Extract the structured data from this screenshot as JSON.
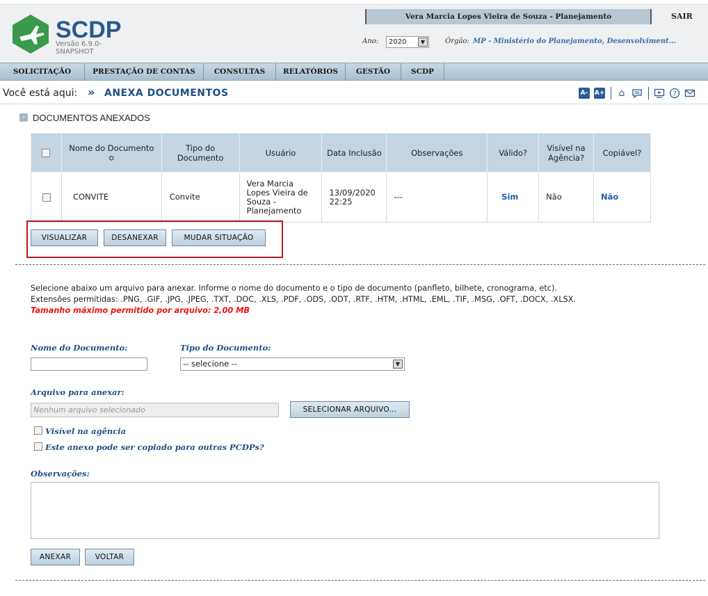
{
  "header": {
    "logo_text": "SCDP",
    "version": "Versão 6.9.0-",
    "version_tag": "SNAPSHOT",
    "user": "Vera Marcia Lopes Vieira de Souza - Planejamento",
    "logout": "SAIR",
    "ano_label": "Ano:",
    "ano_value": "2020",
    "orgao_label": "Órgão:",
    "orgao_value": "MP - Ministério do Planejamento, Desenvolviment...",
    "brand_color": "#2a5a8a",
    "logo_color": "#3a9a4a"
  },
  "nav": {
    "items": [
      "SOLICITAÇÃO",
      "PRESTAÇÃO DE CONTAS",
      "CONSULTAS",
      "RELATÓRIOS",
      "GESTÃO",
      "SCDP"
    ]
  },
  "breadcrumb": {
    "label": "Você está aqui:",
    "current": "ANEXA DOCUMENTOS",
    "tools": [
      "A-",
      "A+",
      "home-icon",
      "chat-icon",
      "video-icon",
      "help-icon",
      "mail-icon"
    ]
  },
  "section": {
    "title": "DOCUMENTOS ANEXADOS",
    "columns": [
      "Nome do Documento ≎",
      "Tipo do Documento",
      "Usuário",
      "Data Inclusão",
      "Observações",
      "Válido?",
      "Visível na Agência?",
      "Copiável?"
    ],
    "rows": [
      {
        "nome": "CONVITE",
        "tipo": "Convite",
        "usuario": "Vera Marcia Lopes Vieira de Souza - Planejamento",
        "data": "13/09/2020 22:25",
        "obs": "---",
        "valido": "Sim",
        "visivel": "Não",
        "copiavel": "Não"
      }
    ],
    "buttons": {
      "visualizar": "VISUALIZAR",
      "desanexar": "DESANEXAR",
      "mudar": "MUDAR SITUAÇÃO"
    }
  },
  "upload": {
    "info_line1": "Selecione abaixo um arquivo para anexar. Informe o nome do documento e o tipo de documento (panfleto, bilhete, cronograma, etc).",
    "info_line2": "Extensões permitidas: .PNG, .GIF, .JPG, .JPEG, .TXT, .DOC, .XLS, .PDF, .ODS, .ODT, .RTF, .HTM, .HTML, .EML, .TIF, .MSG, .OFT, .DOCX, .XLSX.",
    "max_size": "Tamanho máximo permitido por arquivo: 2,00 MB",
    "nome_label": "Nome do Documento:",
    "nome_value": "",
    "tipo_label": "Tipo do Documento:",
    "tipo_value": "-- selecione --",
    "arquivo_label": "Arquivo para anexar:",
    "arquivo_placeholder": "Nenhum arquivo selecionado",
    "selecionar_button": "SELECIONAR ARQUIVO...",
    "visivel_label": "Visível na agência",
    "copiavel_label": "Este anexo pode ser copiado para outras PCDPs?",
    "obs_label": "Observações:",
    "obs_value": "",
    "anexar_button": "ANEXAR",
    "voltar_button": "VOLTAR"
  }
}
